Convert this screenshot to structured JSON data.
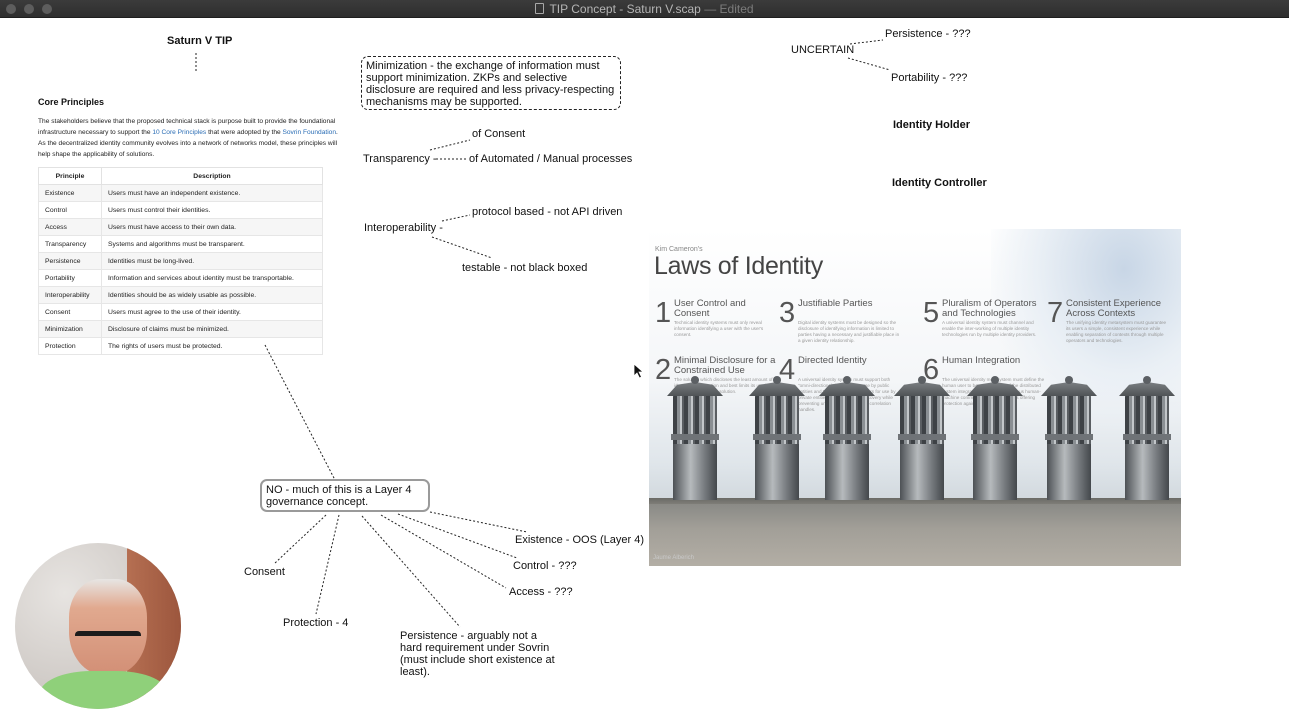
{
  "window": {
    "title": "TIP Concept - Saturn V.scap",
    "edited_suffix": "— Edited"
  },
  "root": {
    "label": "Saturn V TIP"
  },
  "core_principles": {
    "heading": "Core Principles",
    "para_1": "The stakeholders believe that the proposed technical stack is purpose built to provide the foundational infrastructure necessary to support the ",
    "link_1": "10 Core Principles",
    "para_2": " that were adopted by the ",
    "link_2": "Sovrin Foundation",
    "para_3": ". As the decentralized identity community evolves into a network of networks model, these principles will help shape the applicability of solutions.",
    "columns": [
      "Principle",
      "Description"
    ],
    "rows": [
      [
        "Existence",
        "Users must have an independent existence."
      ],
      [
        "Control",
        "Users must control their identities."
      ],
      [
        "Access",
        "Users must have access to their own data."
      ],
      [
        "Transparency",
        "Systems and algorithms must be transparent."
      ],
      [
        "Persistence",
        "Identities must be long-lived."
      ],
      [
        "Portability",
        "Information and services about identity must be transportable."
      ],
      [
        "Interoperability",
        "Identities should be as widely usable as possible."
      ],
      [
        "Consent",
        "Users must agree to the use of their identity."
      ],
      [
        "Minimization",
        "Disclosure of claims must be minimized."
      ],
      [
        "Protection",
        "The rights of users must be protected."
      ]
    ]
  },
  "mindmap": {
    "minimization_note": "Minimization - the exchange of information must support minimization. ZKPs and selective disclosure are required and less privacy-respecting mechanisms may be supported.",
    "transparency": "Transparency -",
    "of_consent": "of Consent",
    "of_processes": "of Automated / Manual processes",
    "interoperability": "Interoperability -",
    "protocol_based": "protocol based - not API driven",
    "testable": "testable - not black boxed",
    "uncertain": "UNCERTAIN",
    "persistence_q": "Persistence - ???",
    "portability_q": "Portability - ???",
    "identity_holder": "Identity Holder",
    "identity_controller": "Identity Controller",
    "layer4_note": "NO - much of this is a Layer 4 governance concept.",
    "existence_oos": "Existence - OOS (Layer 4)",
    "control_q": "Control - ???",
    "access_q": "Access - ???",
    "consent": "Consent",
    "protection": "Protection - 4",
    "persistence_note": "Persistence - arguably not a hard requirement under Sovrin (must include short existence at least)."
  },
  "poster": {
    "subtitle": "Kim Cameron's",
    "title": "Laws of Identity",
    "laws": [
      {
        "num": "1",
        "title": "User Control and Consent",
        "desc": "Technical identity systems must only reveal information identifying a user with the user's consent."
      },
      {
        "num": "2",
        "title": "Minimal Disclosure for a Constrained Use",
        "desc": "The solution which discloses the least amount of identifying information and best limits its use is the most stable long term solution."
      },
      {
        "num": "3",
        "title": "Justifiable Parties",
        "desc": "Digital identity systems must be designed so the disclosure of identifying information is limited to parties having a necessary and justifiable place in a given identity relationship."
      },
      {
        "num": "4",
        "title": "Directed Identity",
        "desc": "A universal identity system must support both \"omni-directional\" identifiers for use by public entities and \"unidirectional\" identifiers for use by private entities, thus facilitating discovery while preventing unnecessary release of correlation handles."
      },
      {
        "num": "5",
        "title": "Pluralism of Operators and Technologies",
        "desc": "A universal identity system must channel and enable the inter-working of multiple identity technologies run by multiple identity providers."
      },
      {
        "num": "6",
        "title": "Human Integration",
        "desc": "The universal identity metasystem must define the human user to be a component of the distributed system integrated through unambiguous human-machine communication mechanisms offering protection against identity attacks."
      },
      {
        "num": "7",
        "title": "Consistent Experience Across Contexts",
        "desc": "The unifying identity metasystem must guarantee its users a simple, consistent experience while enabling separation of contexts through multiple operators and technologies."
      }
    ],
    "credit": "Jaume Alberich"
  },
  "colors": {
    "titlebar": "#333333",
    "link": "#2a6db5",
    "webcam_shirt": "#8fd07a"
  }
}
